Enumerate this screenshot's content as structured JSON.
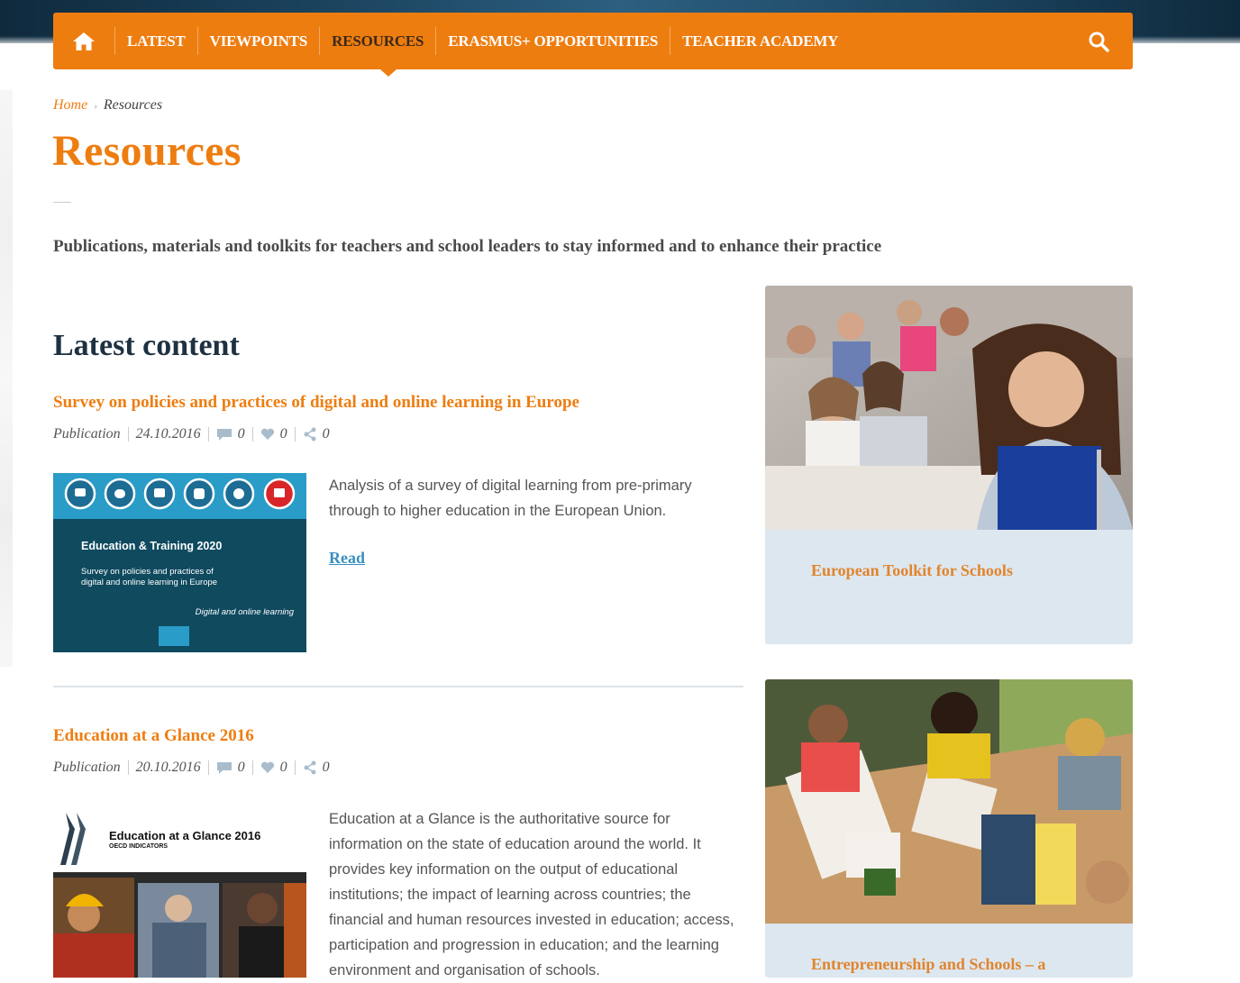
{
  "nav": {
    "items": [
      {
        "label": "LATEST"
      },
      {
        "label": "VIEWPOINTS"
      },
      {
        "label": "RESOURCES"
      },
      {
        "label": "ERASMUS+ OPPORTUNITIES"
      },
      {
        "label": "TEACHER ACADEMY"
      }
    ],
    "active_index": 2,
    "home_icon": "home-icon",
    "search_icon": "search-icon"
  },
  "breadcrumb": {
    "home": "Home",
    "separator": "›",
    "current": "Resources"
  },
  "page": {
    "title": "Resources",
    "intro": "Publications, materials and toolkits for teachers and school leaders to stay informed and to enhance their practice",
    "latest_heading": "Latest content"
  },
  "articles": [
    {
      "title": "Survey on policies and practices of digital and online learning in Europe",
      "type": "Publication",
      "date": "24.10.2016",
      "comments": "0",
      "likes": "0",
      "shares": "0",
      "description": "Analysis of a survey of digital learning from pre-primary through to higher education in the European Union.",
      "read_label": "Read",
      "thumb": {
        "heading": "Education & Training 2020",
        "subtitle_line1": "Survey on policies and practices of",
        "subtitle_line2": "digital and online learning in Europe",
        "tagline": "Digital and online learning"
      }
    },
    {
      "title": "Education at a Glance 2016",
      "type": "Publication",
      "date": "20.10.2016",
      "comments": "0",
      "likes": "0",
      "shares": "0",
      "description": "Education at a Glance is the authoritative source for information on the state of education around the world. It provides key information on the output of educational institutions; the impact of learning across countries; the financial and human resources invested in education; access, participation and progression in education; and the learning environment and organisation of schools.",
      "thumb": {
        "heading": "Education at a Glance 2016",
        "subtitle": "OECD INDICATORS"
      }
    }
  ],
  "sidebar_cards": [
    {
      "title": "European Toolkit for Schools"
    },
    {
      "title": "Entrepreneurship and Schools – a"
    }
  ],
  "colors": {
    "accent": "#ee7d10",
    "heading": "#1e3142",
    "link": "#3a8fbf",
    "card_bg": "#dde7f0"
  }
}
